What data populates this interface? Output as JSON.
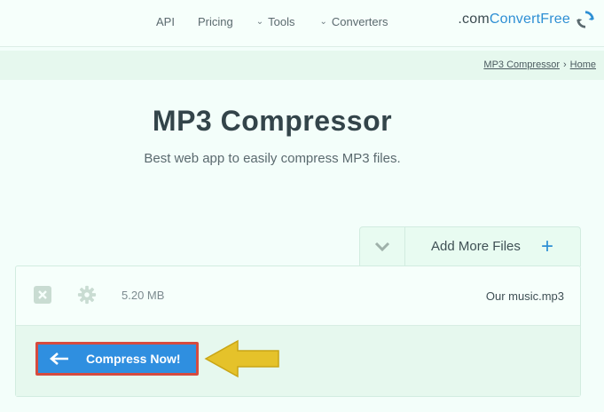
{
  "header": {
    "logo": {
      "free": "Free",
      "convert": "Convert",
      "domain": ".com"
    },
    "nav": {
      "api": "API",
      "pricing": "Pricing",
      "tools": "Tools",
      "converters": "Converters"
    }
  },
  "breadcrumb": {
    "home": "Home",
    "separator": "›",
    "current": "MP3 Compressor"
  },
  "page": {
    "title": "MP3 Compressor",
    "subtitle": "Best web app to easily compress MP3 files."
  },
  "uploader": {
    "add_more_label": "Add More Files",
    "file": {
      "name": "Our music.mp3",
      "size": "5.20 MB"
    },
    "compress_label": "Compress Now!"
  },
  "colors": {
    "accent": "#2e8fd4",
    "button": "#2f8fe0",
    "highlight_border": "#d64b3f",
    "pointer": "#e5c22a"
  }
}
